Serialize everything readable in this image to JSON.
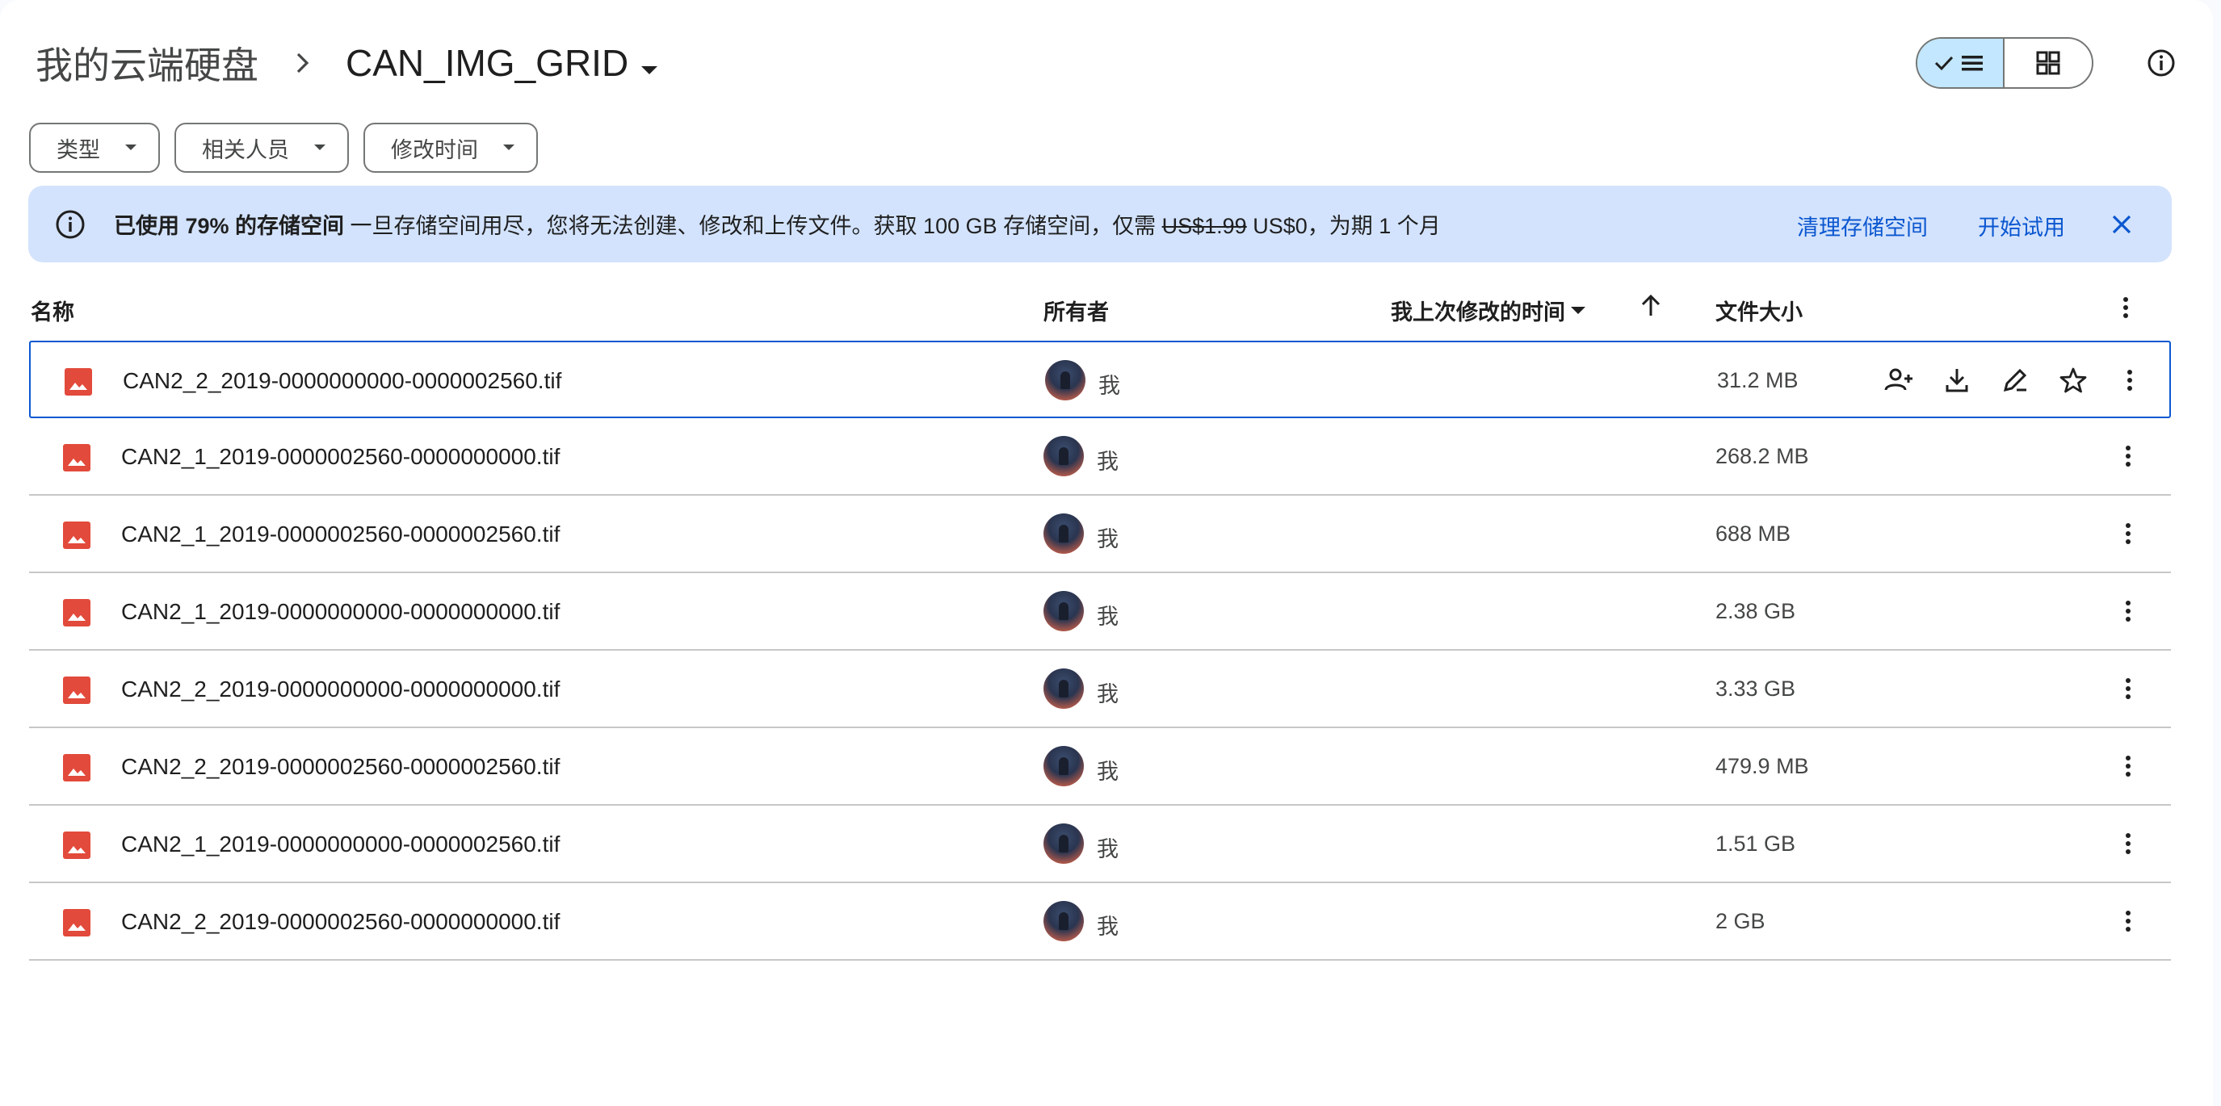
{
  "breadcrumb": {
    "root": "我的云端硬盘",
    "current": "CAN_IMG_GRID"
  },
  "view": {
    "list_icon": "check-list-icon",
    "grid_icon": "grid-icon",
    "info_icon": "info-icon"
  },
  "filters": [
    "类型",
    "相关人员",
    "修改时间"
  ],
  "banner": {
    "bold": "已使用 79% 的存储空间",
    "text1": " 一旦存储空间用尽，您将无法创建、修改和上传文件。获取 100 GB 存储空间，仅需 ",
    "old_price": "US$1.99",
    "text2": " US$0，为期 1 个月",
    "link_clean": "清理存储空间",
    "link_trial": "开始试用",
    "bg_color": "#d3e3fd",
    "link_color": "#0b57d0"
  },
  "table": {
    "headers": {
      "name": "名称",
      "owner": "所有者",
      "modified": "我上次修改的时间",
      "size": "文件大小"
    },
    "rows": [
      {
        "name": "CAN2_2_2019-0000000000-0000002560.tif",
        "owner": "我",
        "size": "31.2 MB"
      },
      {
        "name": "CAN2_1_2019-0000002560-0000000000.tif",
        "owner": "我",
        "size": "268.2 MB"
      },
      {
        "name": "CAN2_1_2019-0000002560-0000002560.tif",
        "owner": "我",
        "size": "688 MB"
      },
      {
        "name": "CAN2_1_2019-0000000000-0000000000.tif",
        "owner": "我",
        "size": "2.38 GB"
      },
      {
        "name": "CAN2_2_2019-0000000000-0000000000.tif",
        "owner": "我",
        "size": "3.33 GB"
      },
      {
        "name": "CAN2_2_2019-0000002560-0000002560.tif",
        "owner": "我",
        "size": "479.9 MB"
      },
      {
        "name": "CAN2_1_2019-0000000000-0000002560.tif",
        "owner": "我",
        "size": "1.51 GB"
      },
      {
        "name": "CAN2_2_2019-0000002560-0000000000.tif",
        "owner": "我",
        "size": "2 GB"
      }
    ]
  },
  "colors": {
    "accent": "#0b57d0",
    "image_icon": "#e24a3b",
    "toggle_active": "#c2e7ff"
  }
}
